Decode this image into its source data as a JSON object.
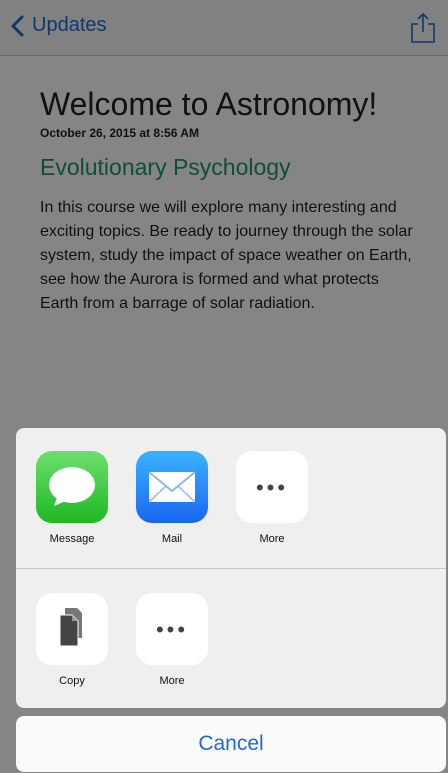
{
  "navbar": {
    "back_label": "Updates"
  },
  "article": {
    "title": "Welcome to Astronomy!",
    "date": "October 26, 2015 at 8:56 AM",
    "course": "Evolutionary Psychology",
    "body": "In this course we will explore many interesting and exciting topics. Be ready to journey through the solar system, study the impact of space weather on Earth, see how the Aurora is formed and what protects Earth from a barrage of solar radiation."
  },
  "share_sheet": {
    "apps": [
      {
        "label": "Message",
        "icon": "message-icon"
      },
      {
        "label": "Mail",
        "icon": "mail-icon"
      },
      {
        "label": "More",
        "icon": "more-icon"
      }
    ],
    "actions": [
      {
        "label": "Copy",
        "icon": "copy-icon"
      },
      {
        "label": "More",
        "icon": "more-icon"
      }
    ],
    "cancel_label": "Cancel"
  },
  "colors": {
    "accent": "#1e6bd6",
    "course_title": "#1b9a63"
  }
}
